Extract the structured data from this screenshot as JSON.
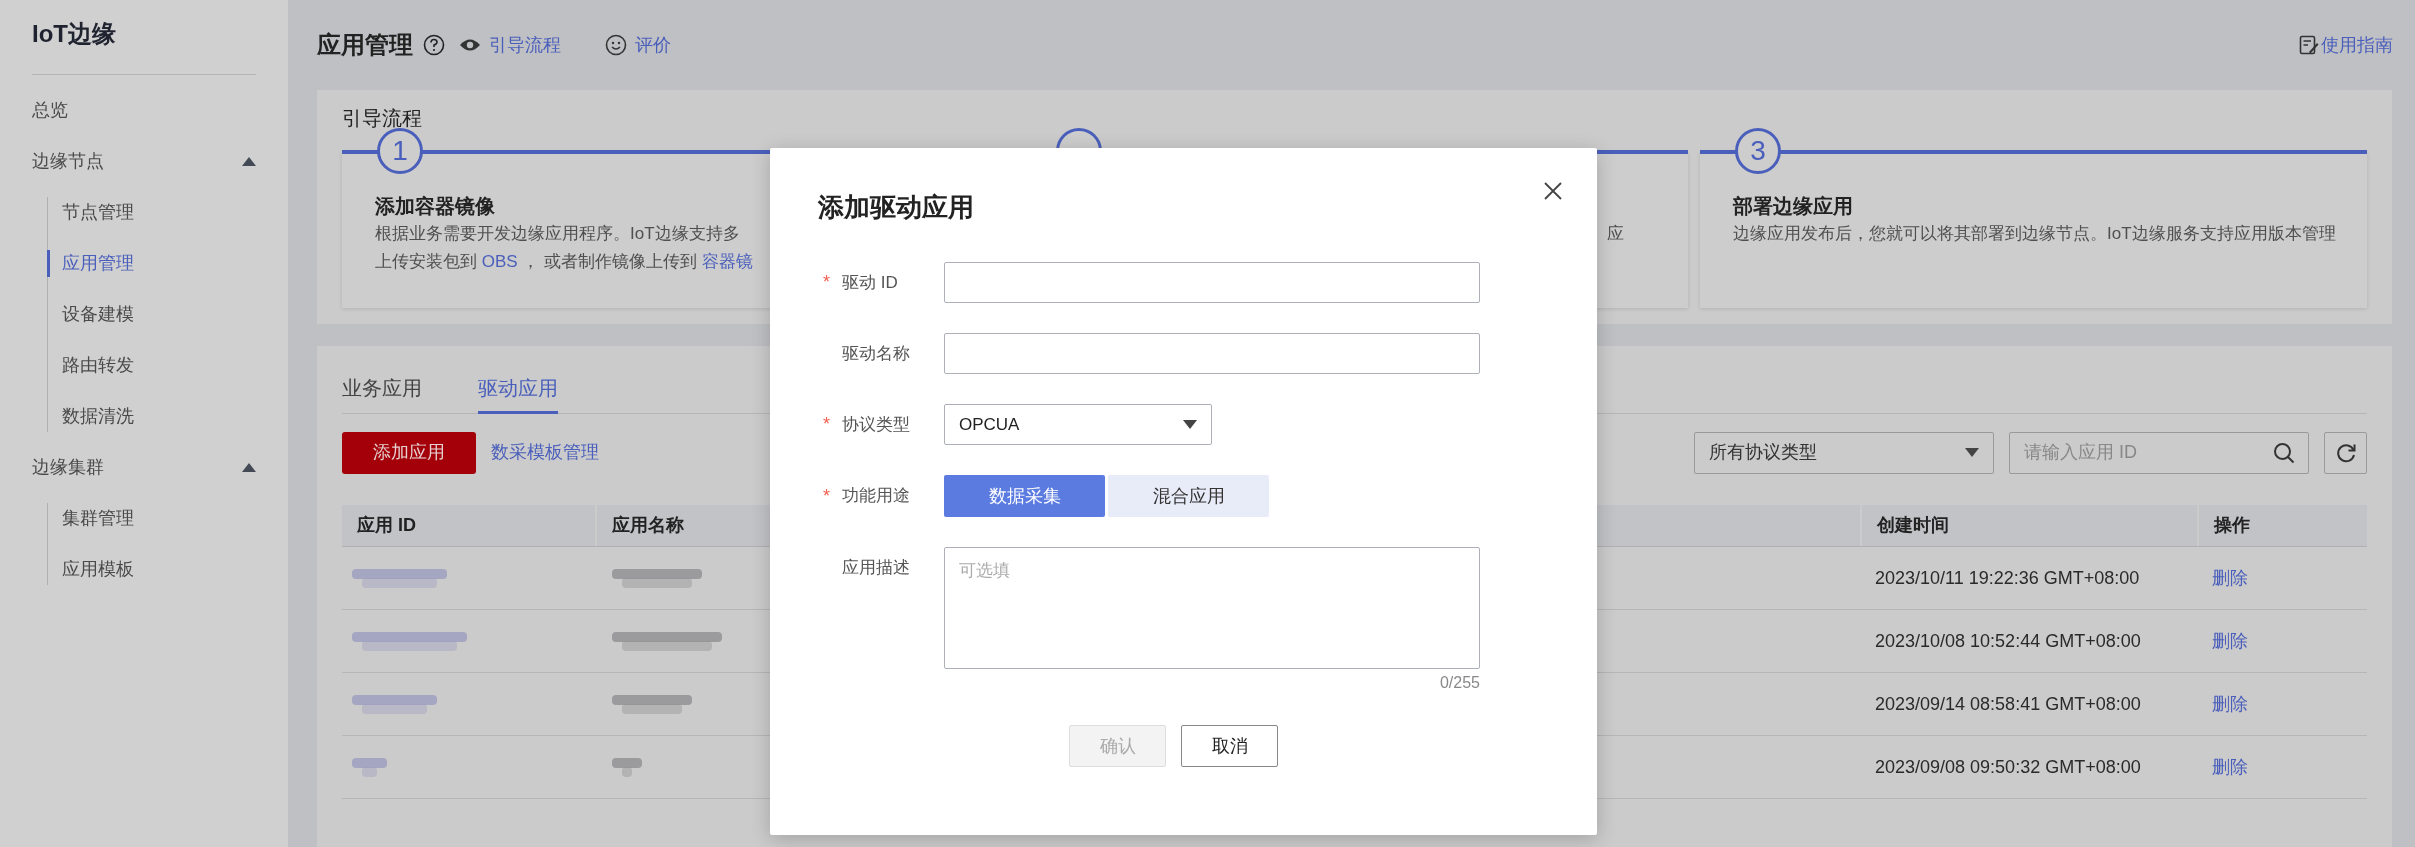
{
  "sidebar": {
    "title": "IoT边缘",
    "items": [
      {
        "label": "总览",
        "selected": false
      },
      {
        "label": "边缘节点",
        "expanded": true,
        "children": [
          {
            "label": "节点管理",
            "selected": false
          },
          {
            "label": "应用管理",
            "selected": true
          },
          {
            "label": "设备建模",
            "selected": false
          },
          {
            "label": "路由转发",
            "selected": false
          },
          {
            "label": "数据清洗",
            "selected": false
          }
        ]
      },
      {
        "label": "边缘集群",
        "expanded": true,
        "children": [
          {
            "label": "集群管理",
            "selected": false
          },
          {
            "label": "应用模板",
            "selected": false
          }
        ]
      }
    ]
  },
  "header": {
    "title": "应用管理",
    "links": [
      {
        "kind": "eye",
        "label": "引导流程"
      },
      {
        "kind": "smile",
        "label": "评价"
      }
    ],
    "guide_link": "使用指南"
  },
  "guide": {
    "title": "引导流程",
    "steps": [
      {
        "number": "1",
        "title": "添加容器镜像",
        "lines": [
          [
            {
              "text": "根据业务需要开发边缘应用程序。IoT边缘支持多",
              "link": false
            }
          ],
          [
            {
              "text": "上传安装包到 ",
              "link": false
            },
            {
              "text": "OBS",
              "link": true
            },
            {
              "text": " ， 或者制作镜像上传到 ",
              "link": false
            },
            {
              "text": "容器镜",
              "link": true
            }
          ]
        ]
      },
      {
        "lines": [
          [
            {
              "text": "应",
              "link": false
            }
          ]
        ]
      },
      {
        "number": "3",
        "title": "部署边缘应用",
        "lines": [
          [
            {
              "text": "边缘应用发布后，您就可以将其部署到边缘节点。IoT边缘服务支持应用版本管理",
              "link": false
            }
          ]
        ]
      }
    ]
  },
  "tabs": [
    {
      "label": "业务应用",
      "selected": false
    },
    {
      "label": "驱动应用",
      "selected": true
    }
  ],
  "toolbar": {
    "add_button": "添加应用",
    "template_link": "数采模板管理",
    "protocol_filter": "所有协议类型",
    "search": {
      "placeholder": "请输入应用 ID"
    }
  },
  "table": {
    "columns": [
      "应用 ID",
      "应用名称",
      "创建时间",
      "操作"
    ],
    "rows": [
      {
        "created": "2023/10/11 19:22:36 GMT+08:00",
        "action": "删除"
      },
      {
        "created": "2023/10/08 10:52:44 GMT+08:00",
        "action": "删除"
      },
      {
        "created": "2023/09/14 08:58:41 GMT+08:00",
        "action": "删除"
      },
      {
        "created": "2023/09/08 09:50:32 GMT+08:00",
        "action": "删除"
      }
    ]
  },
  "dialog": {
    "title": "添加驱动应用",
    "required_mark": "*",
    "fields": [
      {
        "kind": "text",
        "label": "驱动 ID",
        "required": true
      },
      {
        "kind": "text",
        "label": "驱动名称",
        "required": false
      },
      {
        "kind": "select",
        "label": "协议类型",
        "required": true,
        "value": "OPCUA"
      },
      {
        "kind": "segmented",
        "label": "功能用途",
        "required": true,
        "options": [
          {
            "label": "数据采集",
            "selected": true
          },
          {
            "label": "混合应用",
            "selected": false
          }
        ]
      },
      {
        "kind": "textarea",
        "label": "应用描述",
        "required": false,
        "placeholder": "可选填",
        "counter": "0/255"
      }
    ],
    "buttons": [
      {
        "label": "确认",
        "disabled": true
      },
      {
        "label": "取消",
        "disabled": false
      }
    ]
  }
}
